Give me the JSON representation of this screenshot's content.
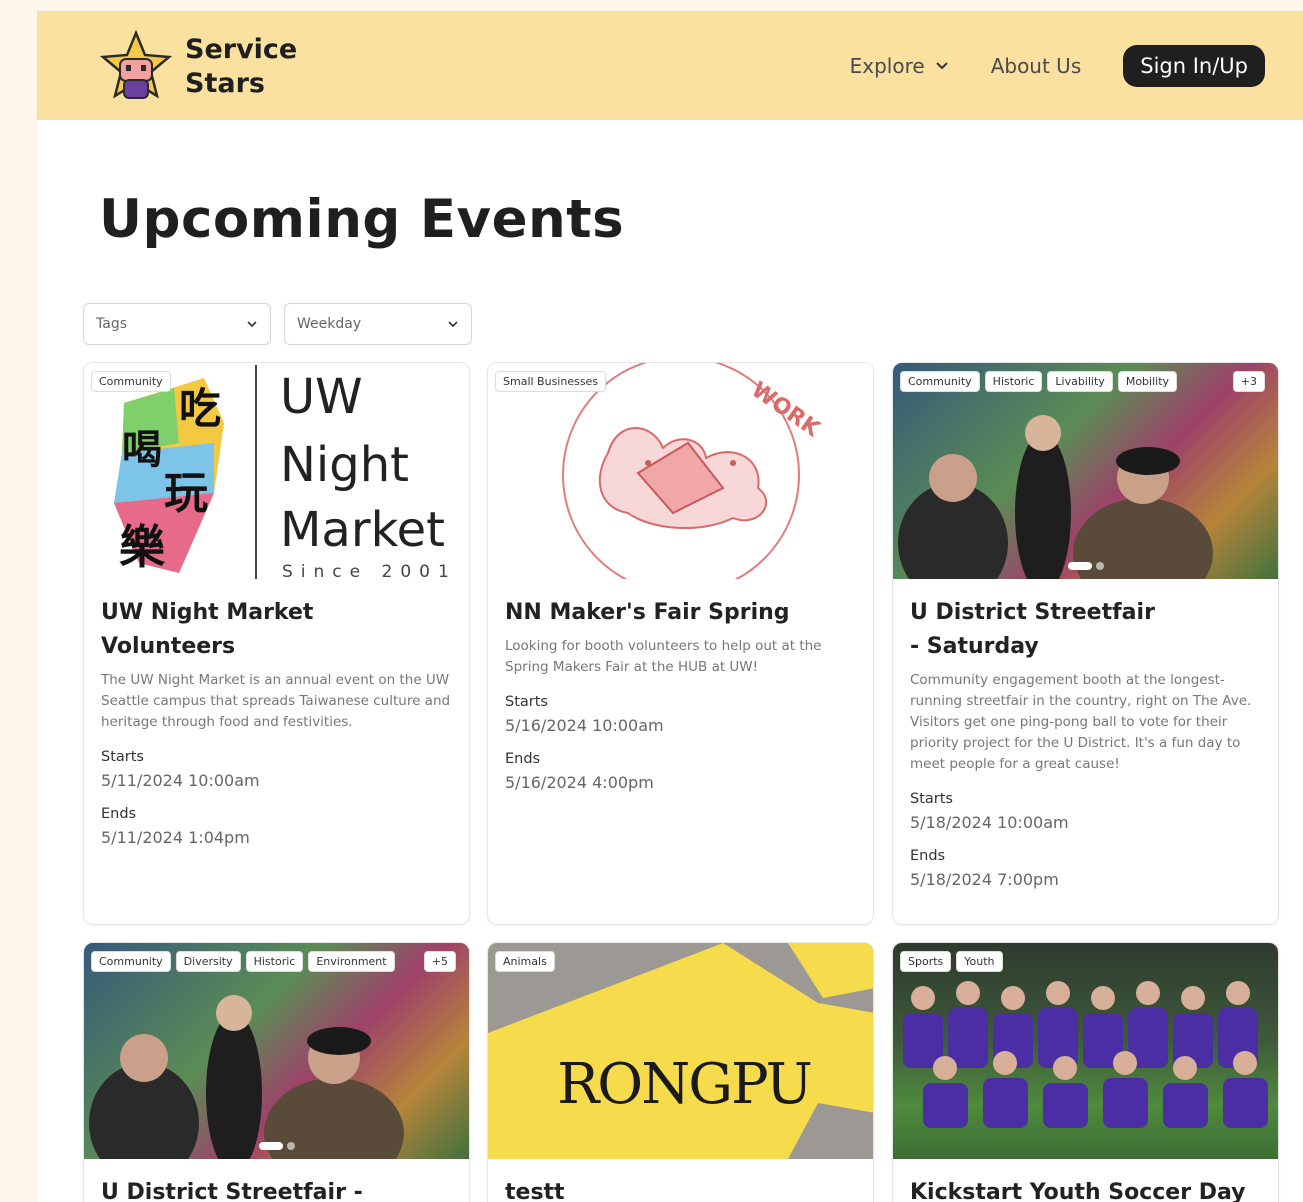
{
  "header": {
    "brand_line1": "Service",
    "brand_line2": "Stars",
    "nav_explore": "Explore",
    "nav_about": "About Us",
    "signin": "Sign In/Up"
  },
  "page": {
    "title": "Upcoming Events"
  },
  "filters": {
    "tags": "Tags",
    "weekday": "Weekday"
  },
  "labels": {
    "starts": "Starts",
    "ends": "Ends"
  },
  "events": [
    {
      "tags": [
        "Community"
      ],
      "more": "",
      "image_text_zh": "吃喝玩樂",
      "image_text_1": "UW",
      "image_text_2": "Night",
      "image_text_3": "Market",
      "image_text_4": "Since 2001",
      "title": "UW Night Market Volunteers",
      "desc": "The UW Night Market is an annual event on the UW Seattle campus that spreads Taiwanese culture and heritage through food and festivities.",
      "starts": "5/11/2024 10:00am",
      "ends": "5/11/2024 1:04pm"
    },
    {
      "tags": [
        "Small Businesses"
      ],
      "more": "",
      "image_text_1": "WORK",
      "title": "NN Maker's Fair Spring",
      "desc": "Looking for booth volunteers to help out at the Spring Makers Fair at the HUB at UW!",
      "starts": "5/16/2024 10:00am",
      "ends": "5/16/2024 4:00pm"
    },
    {
      "tags": [
        "Community",
        "Historic",
        "Livability",
        "Mobility"
      ],
      "more": "+3",
      "title_line1": "U District Streetfair",
      "title_line2": "- Saturday",
      "desc": "Community engagement booth at the longest-running streetfair in the country, right on The Ave. Visitors get one ping-pong ball to vote for their priority project for the U District. It's a fun day to meet people for a great cause!",
      "starts": "5/18/2024 10:00am",
      "ends": "5/18/2024 7:00pm"
    },
    {
      "tags": [
        "Community",
        "Diversity",
        "Historic",
        "Environment"
      ],
      "more": "+5",
      "title": "U District Streetfair - Sunday"
    },
    {
      "tags": [
        "Animals"
      ],
      "more": "",
      "image_text_1": "RONGPU",
      "title": "testt"
    },
    {
      "tags": [
        "Sports",
        "Youth"
      ],
      "more": "",
      "title": "Kickstart Youth Soccer Day"
    }
  ],
  "colors": {
    "header_bg": "#fbe1a0",
    "button_bg": "#1f1f1f",
    "page_bg": "#fdf6ea"
  }
}
